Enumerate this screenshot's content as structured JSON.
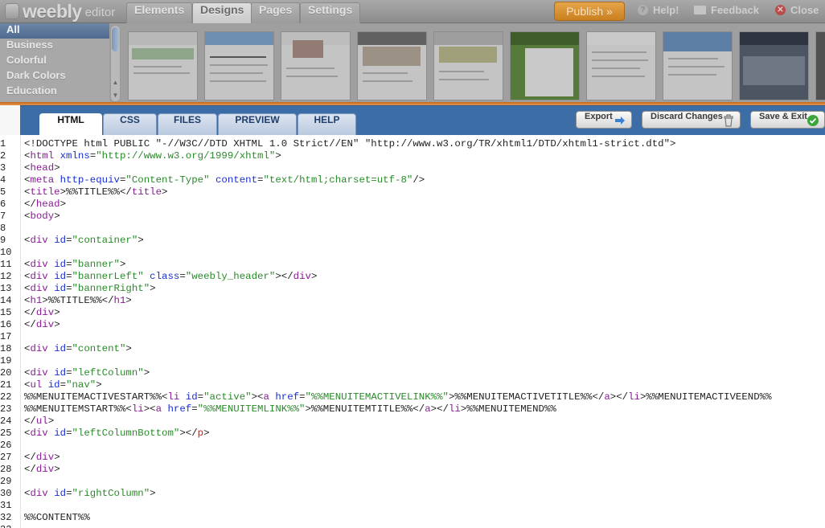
{
  "app": {
    "logo": "weebly",
    "logo_sub": "editor"
  },
  "nav": {
    "tabs": [
      {
        "label": "Elements",
        "active": false
      },
      {
        "label": "Designs",
        "active": true
      },
      {
        "label": "Pages",
        "active": false
      },
      {
        "label": "Settings",
        "active": false
      }
    ]
  },
  "top_actions": {
    "publish": "Publish »",
    "help": "Help!",
    "feedback": "Feedback",
    "close": "Close"
  },
  "design_categories": [
    {
      "label": "All",
      "active": true
    },
    {
      "label": "Business",
      "active": false
    },
    {
      "label": "Colorful",
      "active": false
    },
    {
      "label": "Dark Colors",
      "active": false
    },
    {
      "label": "Education",
      "active": false
    }
  ],
  "editor_tabs": [
    {
      "label": "HTML",
      "active": true
    },
    {
      "label": "CSS",
      "active": false
    },
    {
      "label": "FILES",
      "active": false
    },
    {
      "label": "PREVIEW",
      "active": false
    },
    {
      "label": "HELP",
      "active": false
    }
  ],
  "toolbar": {
    "export": "Export",
    "discard": "Discard Changes",
    "save": "Save & Exit"
  },
  "colors": {
    "accent_blue": "#3d6da7",
    "publish_orange": "#d98f2c",
    "tag": "#8a1c96",
    "attr": "#1a2fd0",
    "string": "#2b8a2b"
  },
  "code_lines": [
    "<!DOCTYPE html PUBLIC \"-//W3C//DTD XHTML 1.0 Strict//EN\" \"http://www.w3.org/TR/xhtml1/DTD/xhtml1-strict.dtd\">",
    "<html xmlns=\"http://www.w3.org/1999/xhtml\">",
    "<head>",
    "<meta http-equiv=\"Content-Type\" content=\"text/html;charset=utf-8\"/>",
    "<title>%%TITLE%%</title>",
    "</head>",
    "<body>",
    "",
    "<div id=\"container\">",
    "",
    "<div id=\"banner\">",
    "<div id=\"bannerLeft\" class=\"weebly_header\"></div>",
    "<div id=\"bannerRight\">",
    "<h1>%%TITLE%%</h1>",
    "</div>",
    "</div>",
    "",
    "<div id=\"content\">",
    "",
    "<div id=\"leftColumn\">",
    "<ul id=\"nav\">",
    "%%MENUITEMACTIVESTART%%<li id=\"active\"><a href=\"%%MENUITEMACTIVELINK%%\">%%MENUITEMACTIVETITLE%%</a></li>%%MENUITEMACTIVEEND%%",
    "%%MENUITEMSTART%%<li><a href=\"%%MENUITEMLINK%%\">%%MENUITEMTITLE%%</a></li>%%MENUITEMEND%%",
    "</ul>",
    "<div id=\"leftColumnBottom\"></p>",
    "",
    "</div>",
    "</div>",
    "",
    "<div id=\"rightColumn\">",
    "",
    "%%CONTENT%%",
    ""
  ]
}
